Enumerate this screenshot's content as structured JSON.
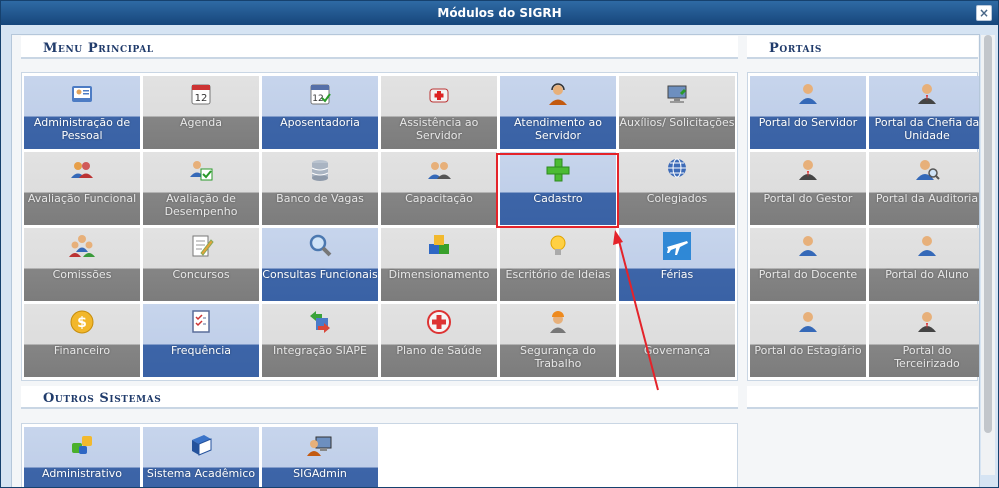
{
  "window": {
    "title": "Módulos do SIGRH",
    "close_symbol": "×"
  },
  "menu_principal": {
    "title": "Menu Principal",
    "tiles": [
      {
        "label": "Administração de Pessoal",
        "icon": "user-card-icon",
        "style": "blue"
      },
      {
        "label": "Agenda",
        "icon": "calendar-icon",
        "style": "gray"
      },
      {
        "label": "Aposentadoria",
        "icon": "calendar-check-icon",
        "style": "blue"
      },
      {
        "label": "Assistência ao Servidor",
        "icon": "first-aid-kit-icon",
        "style": "gray"
      },
      {
        "label": "Atendimento ao Servidor",
        "icon": "headset-user-icon",
        "style": "blue"
      },
      {
        "label": "Auxílios/ Solicitações",
        "icon": "computer-icon",
        "style": "gray"
      },
      {
        "label": "Avaliação Funcional",
        "icon": "users-icon",
        "style": "gray"
      },
      {
        "label": "Avaliação de Desempenho",
        "icon": "user-check-icon",
        "style": "gray"
      },
      {
        "label": "Banco de Vagas",
        "icon": "database-icon",
        "style": "gray"
      },
      {
        "label": "Capacitação",
        "icon": "people-icon",
        "style": "gray"
      },
      {
        "label": "Cadastro",
        "icon": "plus-icon",
        "style": "blue"
      },
      {
        "label": "Colegiados",
        "icon": "globe-icon",
        "style": "gray"
      },
      {
        "label": "Comissões",
        "icon": "group-icon",
        "style": "gray"
      },
      {
        "label": "Concursos",
        "icon": "edit-document-icon",
        "style": "gray"
      },
      {
        "label": "Consultas Funcionais",
        "icon": "magnifier-icon",
        "style": "blue"
      },
      {
        "label": "Dimensionamento",
        "icon": "blocks-icon",
        "style": "gray"
      },
      {
        "label": "Escritório de Ideias",
        "icon": "lightbulb-icon",
        "style": "gray"
      },
      {
        "label": "Férias",
        "icon": "airplane-icon",
        "style": "blue"
      },
      {
        "label": "Financeiro",
        "icon": "dollar-coin-icon",
        "style": "gray"
      },
      {
        "label": "Frequência",
        "icon": "checklist-icon",
        "style": "blue"
      },
      {
        "label": "Integração SIAPE",
        "icon": "sync-arrows-icon",
        "style": "gray"
      },
      {
        "label": "Plano de Saúde",
        "icon": "health-cross-icon",
        "style": "gray"
      },
      {
        "label": "Segurança do Trabalho",
        "icon": "worker-helmet-icon",
        "style": "gray"
      },
      {
        "label": "Governança",
        "icon": "",
        "style": "gray"
      }
    ]
  },
  "portais": {
    "title": "Portais",
    "tiles": [
      {
        "label": "Portal do Servidor",
        "icon": "user-icon",
        "style": "blue"
      },
      {
        "label": "Portal da Chefia da Unidade",
        "icon": "user-tie-icon",
        "style": "blue"
      },
      {
        "label": "Portal do Gestor",
        "icon": "user-tie-icon",
        "style": "gray"
      },
      {
        "label": "Portal da Auditoria",
        "icon": "user-search-icon",
        "style": "gray"
      },
      {
        "label": "Portal do Docente",
        "icon": "user-icon",
        "style": "gray"
      },
      {
        "label": "Portal do Aluno",
        "icon": "user-icon",
        "style": "gray"
      },
      {
        "label": "Portal do Estagiário",
        "icon": "user-icon",
        "style": "gray"
      },
      {
        "label": "Portal do Terceirizado",
        "icon": "user-tie-icon",
        "style": "gray"
      }
    ]
  },
  "outros_sistemas": {
    "title": "Outros Sistemas",
    "tiles": [
      {
        "label": "Administrativo",
        "icon": "modules-icon",
        "style": "blue"
      },
      {
        "label": "Sistema Acadêmico",
        "icon": "book-icon",
        "style": "blue"
      },
      {
        "label": "SIGAdmin",
        "icon": "admin-computer-icon",
        "style": "blue"
      }
    ]
  },
  "annotation": {
    "highlighted_tile": "Cadastro",
    "color": "#e4232a"
  }
}
